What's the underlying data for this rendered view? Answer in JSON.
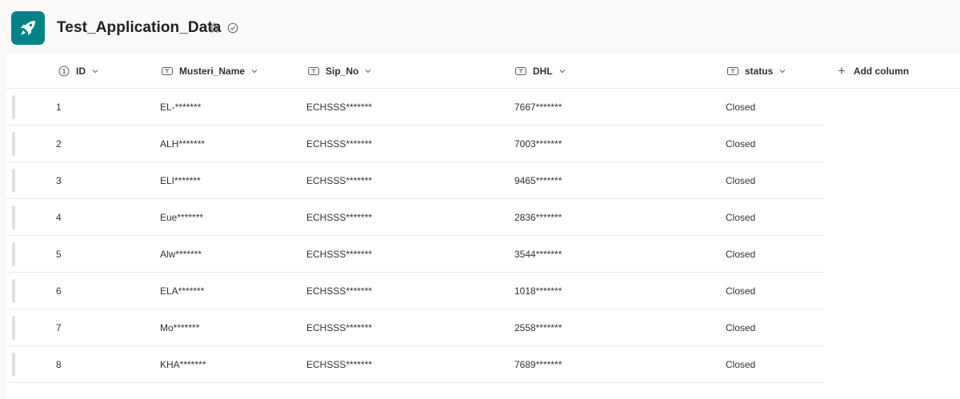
{
  "app": {
    "title": "Test_Application_Data",
    "icon": "rocket-icon",
    "accent_color": "#038387"
  },
  "columns": [
    {
      "key": "id",
      "label": "ID",
      "icon": "number-circle-icon"
    },
    {
      "key": "musteri",
      "label": "Musteri_Name",
      "icon": "text-field-icon"
    },
    {
      "key": "sip",
      "label": "Sip_No",
      "icon": "text-field-icon"
    },
    {
      "key": "dhl",
      "label": "DHL",
      "icon": "text-field-icon"
    },
    {
      "key": "status",
      "label": "status",
      "icon": "text-field-icon"
    }
  ],
  "add_column_label": "Add column",
  "rows": [
    {
      "id": "1",
      "musteri": "EL-*******",
      "sip": "ECHSSS*******",
      "dhl": "7667*******",
      "status": "Closed"
    },
    {
      "id": "2",
      "musteri": "ALH*******",
      "sip": "ECHSSS*******",
      "dhl": "7003*******",
      "status": "Closed"
    },
    {
      "id": "3",
      "musteri": "ELI*******",
      "sip": "ECHSSS*******",
      "dhl": "9465*******",
      "status": "Closed"
    },
    {
      "id": "4",
      "musteri": "Eue*******",
      "sip": "ECHSSS*******",
      "dhl": "2836*******",
      "status": "Closed"
    },
    {
      "id": "5",
      "musteri": "Alw*******",
      "sip": "ECHSSS*******",
      "dhl": "3544*******",
      "status": "Closed"
    },
    {
      "id": "6",
      "musteri": "ELA*******",
      "sip": "ECHSSS*******",
      "dhl": "1018*******",
      "status": "Closed"
    },
    {
      "id": "7",
      "musteri": "Mo*******",
      "sip": "ECHSSS*******",
      "dhl": "2558*******",
      "status": "Closed"
    },
    {
      "id": "8",
      "musteri": "KHA*******",
      "sip": "ECHSSS*******",
      "dhl": "7689*******",
      "status": "Closed"
    }
  ]
}
